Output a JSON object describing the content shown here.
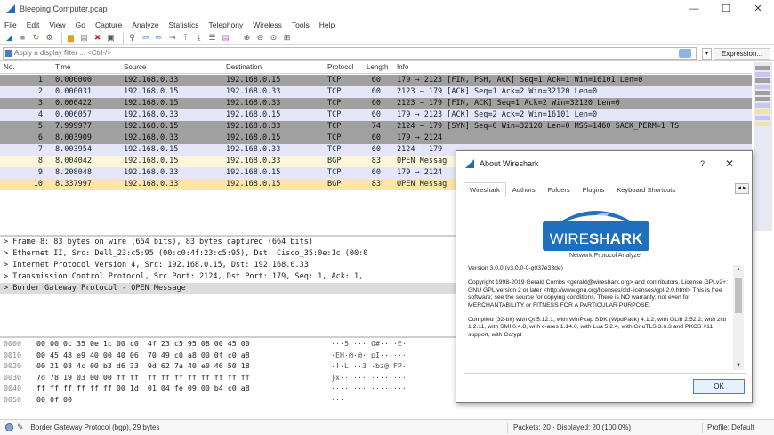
{
  "window": {
    "title": "Bleeping Computer.pcap",
    "min": "—",
    "max": "☐",
    "close": "✕"
  },
  "menu": [
    "File",
    "Edit",
    "View",
    "Go",
    "Capture",
    "Analyze",
    "Statistics",
    "Telephony",
    "Wireless",
    "Tools",
    "Help"
  ],
  "filter": {
    "placeholder": "Apply a display filter ... <Ctrl-/>",
    "expression_label": "Expression...",
    "dropdown": "▾",
    "plus": "+"
  },
  "columns": {
    "no": "No.",
    "time": "Time",
    "source": "Source",
    "destination": "Destination",
    "protocol": "Protocol",
    "length": "Length",
    "info": "Info"
  },
  "packets": [
    {
      "no": "1",
      "time": "0.000000",
      "src": "192.168.0.33",
      "dst": "192.168.0.15",
      "proto": "TCP",
      "len": "60",
      "info": "179 → 2123 [FIN, PSH, ACK] Seq=1 Ack=1 Win=16101 Len=0",
      "style": "c-tcp-fin"
    },
    {
      "no": "2",
      "time": "0.000031",
      "src": "192.168.0.15",
      "dst": "192.168.0.33",
      "proto": "TCP",
      "len": "60",
      "info": "2123 → 179 [ACK] Seq=1 Ack=2 Win=32120 Len=0",
      "style": "c-tcp"
    },
    {
      "no": "3",
      "time": "0.000422",
      "src": "192.168.0.15",
      "dst": "192.168.0.33",
      "proto": "TCP",
      "len": "60",
      "info": "2123 → 179 [FIN, ACK] Seq=1 Ack=2 Win=32120 Len=0",
      "style": "c-tcp-fin"
    },
    {
      "no": "4",
      "time": "0.006057",
      "src": "192.168.0.33",
      "dst": "192.168.0.15",
      "proto": "TCP",
      "len": "60",
      "info": "179 → 2123 [ACK] Seq=2 Ack=2 Win=16101 Len=0",
      "style": "c-tcp"
    },
    {
      "no": "5",
      "time": "7.999977",
      "src": "192.168.0.15",
      "dst": "192.168.0.33",
      "proto": "TCP",
      "len": "74",
      "info": "2124 → 179 [SYN] Seq=0 Win=32120 Len=0 MSS=1460 SACK_PERM=1 TS",
      "style": "c-tcp-fin"
    },
    {
      "no": "6",
      "time": "8.003909",
      "src": "192.168.0.33",
      "dst": "192.168.0.15",
      "proto": "TCP",
      "len": "60",
      "info": "179 → 2124",
      "style": "c-tcp-fin"
    },
    {
      "no": "7",
      "time": "8.003954",
      "src": "192.168.0.15",
      "dst": "192.168.0.33",
      "proto": "TCP",
      "len": "60",
      "info": "2124 → 179",
      "style": "c-tcp"
    },
    {
      "no": "8",
      "time": "8.004042",
      "src": "192.168.0.15",
      "dst": "192.168.0.33",
      "proto": "BGP",
      "len": "83",
      "info": "OPEN Messag",
      "style": "c-bgp"
    },
    {
      "no": "9",
      "time": "8.208048",
      "src": "192.168.0.33",
      "dst": "192.168.0.15",
      "proto": "TCP",
      "len": "60",
      "info": "179 → 2124",
      "style": "c-tcp"
    },
    {
      "no": "10",
      "time": "8.337997",
      "src": "192.168.0.33",
      "dst": "192.168.0.15",
      "proto": "BGP",
      "len": "83",
      "info": "OPEN Messag",
      "style": "c-sel"
    }
  ],
  "details": [
    "> Frame 8: 83 bytes on wire (664 bits), 83 bytes captured (664 bits)",
    "> Ethernet II, Src: Dell_23:c5:95 (00:c0:4f:23:c5:95), Dst: Cisco_35:0e:1c (00:0",
    "> Internet Protocol Version 4, Src: 192.168.0.15, Dst: 192.168.0.33",
    "> Transmission Control Protocol, Src Port: 2124, Dst Port: 179, Seq: 1, Ack: 1,",
    "> Border Gateway Protocol - OPEN Message"
  ],
  "bytes": [
    {
      "off": "0000",
      "hex": "00 00 0c 35 0e 1c 00 c0  4f 23 c5 95 08 00 45 00",
      "asc": "···5···· O#····E·"
    },
    {
      "off": "0010",
      "hex": "00 45 48 e9 40 00 40 06  70 49 c0 a8 00 0f c0 a8",
      "asc": "·EH·@·@· pI······"
    },
    {
      "off": "0020",
      "hex": "00 21 08 4c 00 b3 d6 33  9d 62 7a 40 e0 46 50 18",
      "asc": "·!·L···3 ·bz@·FP·"
    },
    {
      "off": "0030",
      "hex": "7d 78 19 03 00 00 ff ff  ff ff ff ff ff ff ff ff",
      "asc": "}x······ ········"
    },
    {
      "off": "0040",
      "hex": "ff ff ff ff ff ff 00 1d  01 04 fe 09 00 b4 c0 a8",
      "asc": "········ ········"
    },
    {
      "off": "0050",
      "hex": "00 0f 00",
      "asc": "···"
    }
  ],
  "status": {
    "left": "Border Gateway Protocol (bgp), 29 bytes",
    "packets": "Packets: 20 · Displayed: 20 (100.0%)",
    "profile": "Profile: Default"
  },
  "about": {
    "title": "About Wireshark",
    "help": "?",
    "close": "✕",
    "tabs": [
      "Wireshark",
      "Authors",
      "Folders",
      "Plugins",
      "Keyboard Shortcuts"
    ],
    "tab_scroll": "◂ ▸",
    "logo_text": "WIRESHARK",
    "logo_sub": "Network Protocol Analyzer",
    "version": "Version 3.0.0 (v3.0.0-0-g937e33de)",
    "copyright": "Copyright 1998-2019 Gerald Combs <gerald@wireshark.org> and contributors. License GPLv2+: GNU GPL version 2 or later <http://www.gnu.org/licenses/old-licenses/gpl-2.0.html> This is free software; see the source for copying conditions. There is NO warranty; not even for MERCHANTABILITY or FITNESS FOR A PARTICULAR PURPOSE.",
    "compiled": "Compiled (32-bit) with Qt 5.12.1, with WinPcap SDK (WpdPack) 4.1.2, with GLib 2.52.2, with zlib 1.2.11, with SMI 0.4.8, with c-ares 1.14.0, with Lua 5.2.4, with GnuTLS 3.6.3 and PKCS #11 support, with Gcrypt",
    "ok": "OK"
  },
  "colors": {
    "accent": "#1f6fbf",
    "tcp_fin_row": "#a0a0a0",
    "tcp_row": "#e6e6fa",
    "bgp_row": "#fdf6d9"
  }
}
